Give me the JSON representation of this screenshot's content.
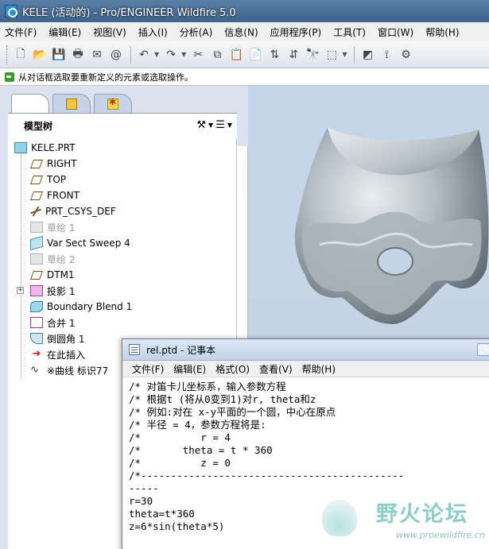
{
  "window": {
    "title": "KELE (活动的) - Pro/ENGINEER Wildfire 5.0"
  },
  "menu": [
    "文件(F)",
    "编辑(E)",
    "视图(V)",
    "插入(I)",
    "分析(A)",
    "信息(N)",
    "应用程序(P)",
    "工具(T)",
    "窗口(W)",
    "帮助(H)"
  ],
  "toolbar": {
    "icons": [
      "new-icon",
      "open-icon",
      "save-icon",
      "print-icon",
      "send-icon",
      "email-icon",
      "undo-icon",
      "redo-icon",
      "cut-icon",
      "copy-icon",
      "paste-icon",
      "paste-special-icon",
      "regenerate-icon",
      "regenerate-manager-icon",
      "find-icon",
      "select-box-icon",
      "repaint-icon",
      "spin-center-icon",
      "orient-icon"
    ]
  },
  "message": {
    "text": "从对话框选取要重新定义的元素或选取操作。"
  },
  "navigator": {
    "tabs": [
      "model-tree-tab",
      "folder-browser-tab",
      "favorites-tab"
    ],
    "tree_title": "模型树",
    "items": [
      {
        "label": "KELE.PRT",
        "icon": "part-icon",
        "dim": false
      },
      {
        "label": "RIGHT",
        "icon": "datum-plane-icon",
        "dim": false
      },
      {
        "label": "TOP",
        "icon": "datum-plane-icon",
        "dim": false
      },
      {
        "label": "FRONT",
        "icon": "datum-plane-icon",
        "dim": false
      },
      {
        "label": "PRT_CSYS_DEF",
        "icon": "csys-icon",
        "dim": false
      },
      {
        "label": "草绘 1",
        "icon": "sketch-icon",
        "dim": true
      },
      {
        "label": "Var Sect Sweep 4",
        "icon": "sweep-icon",
        "dim": false
      },
      {
        "label": "草绘 2",
        "icon": "sketch-icon",
        "dim": true
      },
      {
        "label": "DTM1",
        "icon": "datum-plane-icon",
        "dim": false
      },
      {
        "label": "投影 1",
        "icon": "projection-icon",
        "dim": false
      },
      {
        "label": "Boundary Blend 1",
        "icon": "boundary-blend-icon",
        "dim": false
      },
      {
        "label": "合并 1",
        "icon": "merge-icon",
        "dim": false
      },
      {
        "label": "倒圆角 1",
        "icon": "round-icon",
        "dim": false
      },
      {
        "label": "在此插入",
        "icon": "insert-here-icon",
        "dim": false
      },
      {
        "label": "※曲线 标识77",
        "icon": "curve-icon",
        "dim": false
      }
    ]
  },
  "notepad": {
    "title": "rel.ptd - 记事本",
    "menu": [
      "文件(F)",
      "编辑(E)",
      "格式(O)",
      "查看(V)",
      "帮助(H)"
    ],
    "lines": [
      "/* 对笛卡儿坐标系，输入参数方程",
      "/* 根据t (将从0变到1)对r, theta和z",
      "/* 例如:对在 x-y平面的一个圆，中心在原点",
      "/* 半径 = 4，参数方程将是:",
      "/*          r = 4",
      "/*       theta = t * 360",
      "/*          z = 0",
      "/*--------------------------------------------",
      "-----",
      "r=30",
      "theta=t*360",
      "z=6*sin(theta*5)"
    ]
  },
  "watermark": {
    "title": "野火论坛",
    "url": "www.proewildfire.cn"
  },
  "colors": {
    "titlebar": "#4a6f99",
    "graphics_bg": "#c3d6ea",
    "model_surface": "#9aa5ad"
  }
}
